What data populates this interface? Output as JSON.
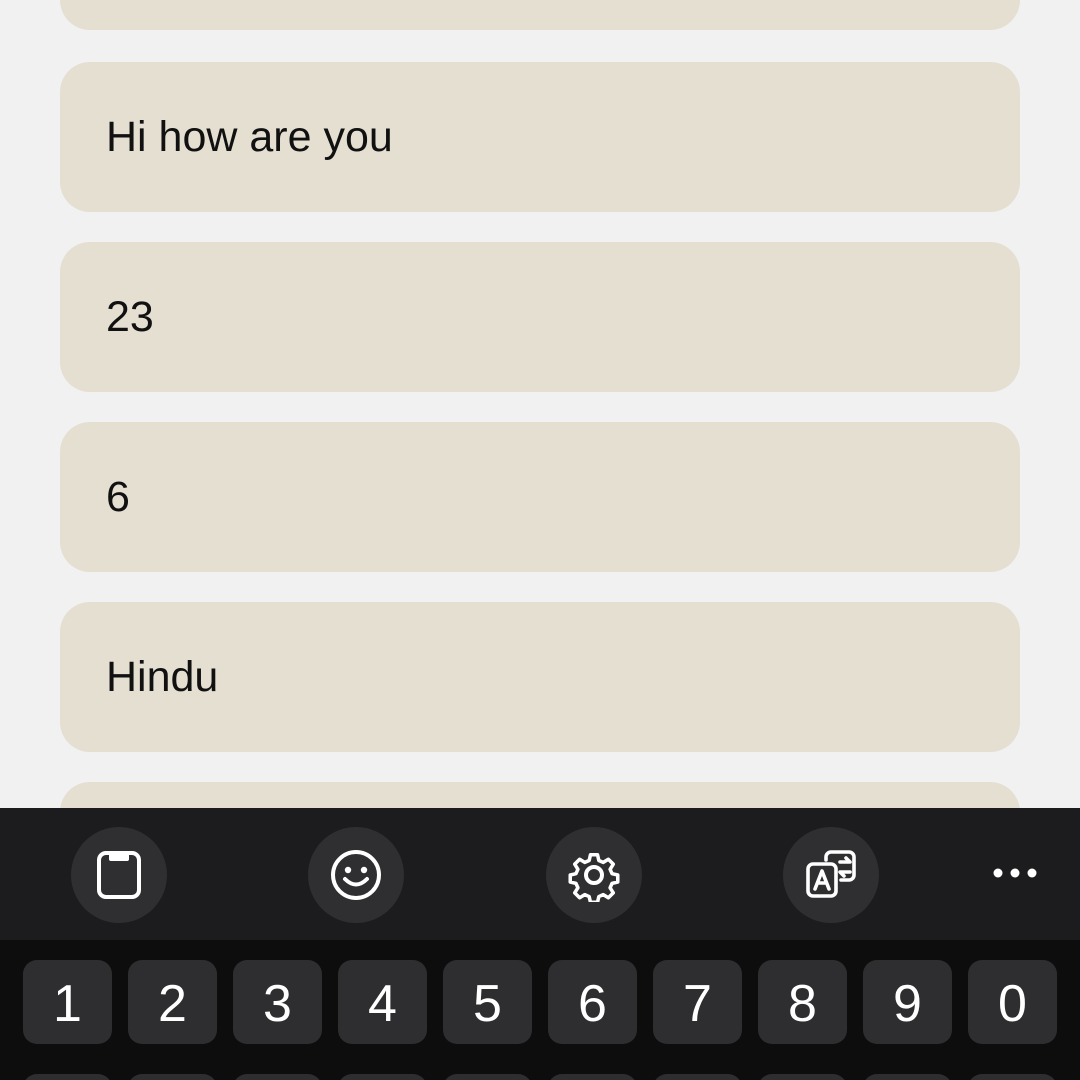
{
  "form": {
    "fields": [
      {
        "value": ""
      },
      {
        "value": "Hi how are you"
      },
      {
        "value": "23"
      },
      {
        "value": "6"
      },
      {
        "value": "Hindu"
      },
      {
        "value": ""
      }
    ]
  },
  "keyboard": {
    "toolbar": [
      {
        "icon": "clipboard-icon"
      },
      {
        "icon": "emoji-icon"
      },
      {
        "icon": "gear-icon"
      },
      {
        "icon": "translate-icon"
      },
      {
        "icon": "more-icon"
      }
    ],
    "number_row": [
      "1",
      "2",
      "3",
      "4",
      "5",
      "6",
      "7",
      "8",
      "9",
      "0"
    ]
  },
  "colors": {
    "background": "#f1f1f1",
    "card": "#e5dfd2",
    "toolbar": "#1c1c1e",
    "keyboard": "#0d0d0d",
    "key": "#2e2e30",
    "key_text": "#ffffff"
  }
}
